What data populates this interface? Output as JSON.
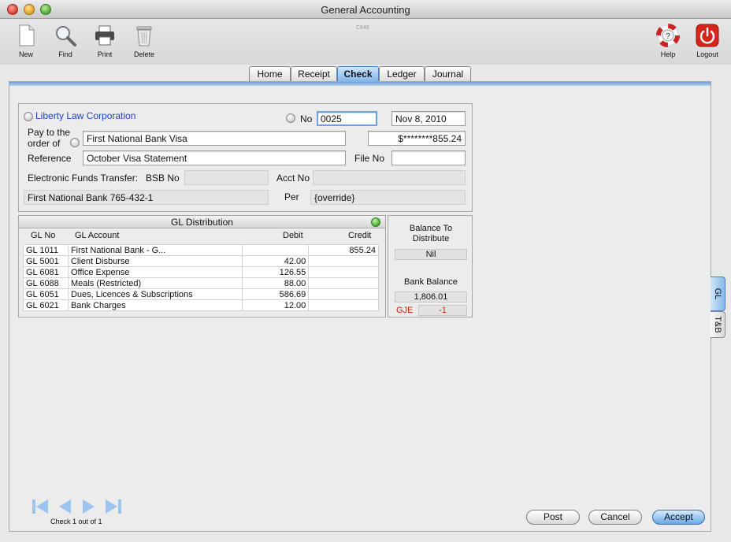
{
  "window": {
    "title": "General Accounting",
    "doc_code": "C846"
  },
  "toolbar": {
    "new": "New",
    "find": "Find",
    "print": "Print",
    "delete": "Delete",
    "help": "Help",
    "logout": "Logout"
  },
  "tabs": [
    "Home",
    "Receipt",
    "Check",
    "Ledger",
    "Journal"
  ],
  "active_tab": "Check",
  "check": {
    "payer": "Liberty Law Corporation",
    "no_label": "No",
    "no_value": "0025",
    "date": "Nov 8, 2010",
    "pay_to_label_1": "Pay to the",
    "pay_to_label_2": "order of",
    "payee": "First National Bank Visa",
    "amount": "$********855.24",
    "reference_label": "Reference",
    "reference": "October Visa Statement",
    "file_no_label": "File No",
    "file_no": "",
    "eft_label": "Electronic Funds Transfer:",
    "bsb_label": "BSB No",
    "bsb": "",
    "acct_label": "Acct No",
    "acct": "",
    "bank_account": "First National Bank 765-432-1",
    "per_label": "Per",
    "per": "{override}"
  },
  "gl": {
    "title": "GL Distribution",
    "headers": {
      "gl_no": "GL No",
      "gl_account": "GL Account",
      "debit": "Debit",
      "credit": "Credit"
    },
    "rows": [
      {
        "gl_no": "GL 1011",
        "account": "First National Bank - G...",
        "debit": "",
        "credit": "855.24"
      },
      {
        "gl_no": "GL 5001",
        "account": "Client Disburse",
        "debit": "42.00",
        "credit": ""
      },
      {
        "gl_no": "GL 6081",
        "account": "Office Expense",
        "debit": "126.55",
        "credit": ""
      },
      {
        "gl_no": "GL 6088",
        "account": "Meals (Restricted)",
        "debit": "88.00",
        "credit": ""
      },
      {
        "gl_no": "GL 6051",
        "account": "Dues, Licences & Subscriptions",
        "debit": "586.69",
        "credit": ""
      },
      {
        "gl_no": "GL 6021",
        "account": "Bank Charges",
        "debit": "12.00",
        "credit": ""
      }
    ]
  },
  "balance": {
    "to_distribute_label_1": "Balance To",
    "to_distribute_label_2": "Distribute",
    "to_distribute": "Nil",
    "bank_balance_label": "Bank Balance",
    "bank_balance": "1,806.01",
    "gje_label": "GJE",
    "gje": "-1"
  },
  "side_tabs": [
    "GL",
    "T&B"
  ],
  "pager": {
    "text": "Check 1 out of 1"
  },
  "buttons": {
    "post": "Post",
    "cancel": "Cancel",
    "accept": "Accept"
  },
  "colors": {
    "accent": "#7fb5ea",
    "link_blue": "#1e3fd0",
    "gje_red": "#cc2200"
  }
}
